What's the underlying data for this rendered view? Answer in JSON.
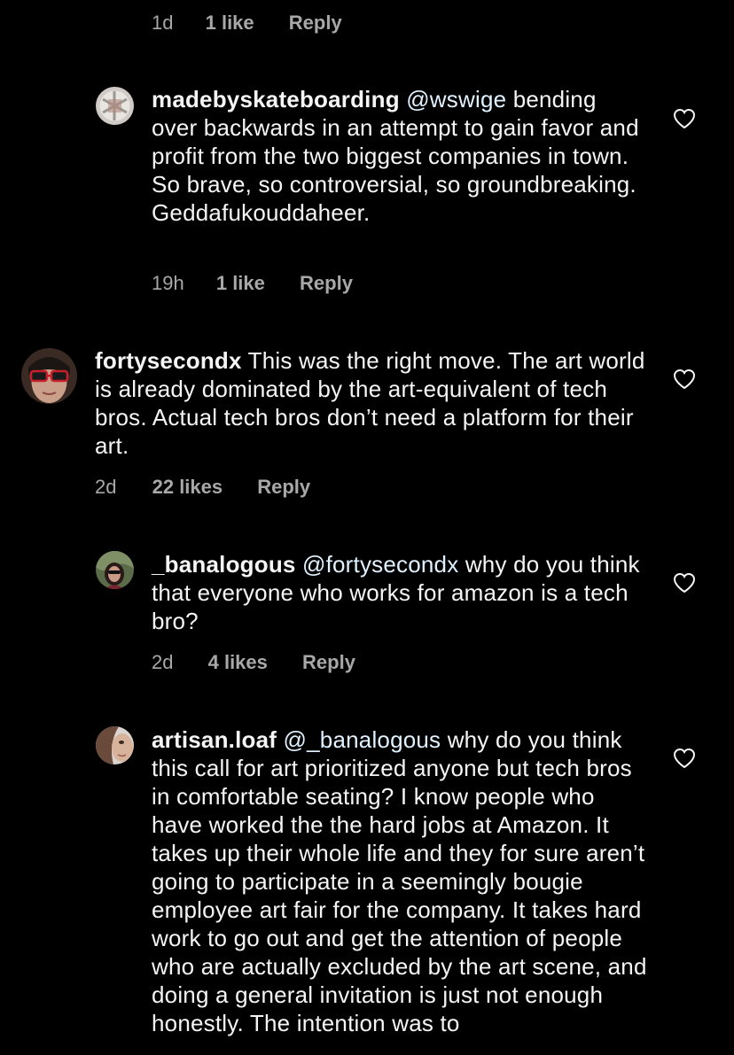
{
  "top_meta": {
    "time": "1d",
    "likes": "1 like",
    "reply": "Reply"
  },
  "comments": [
    {
      "username": "madebyskateboarding",
      "mention": "@wswige",
      "text": " bending over backwards in an attempt to gain favor and profit from the two biggest companies in town. So brave, so controversial, so groundbreaking. Geddafukouddaheer.",
      "time": "19h",
      "likes": "1 like",
      "reply": "Reply"
    },
    {
      "username": "fortysecondx",
      "mention": "",
      "text": " This was the right move. The art world is already dominated by the art-equivalent of tech bros. Actual tech bros don’t need a platform for their art.",
      "time": "2d",
      "likes": "22 likes",
      "reply": "Reply"
    },
    {
      "username": "_banalogous",
      "mention": "@fortysecondx",
      "text": " why do you think that everyone who works for amazon is a tech bro?",
      "time": "2d",
      "likes": "4 likes",
      "reply": "Reply"
    },
    {
      "username": "artisan.loaf",
      "mention": "@_banalogous",
      "text": " why do you think this call for art prioritized anyone but tech bros in comfortable seating? I know people who have worked the the hard jobs at Amazon. It takes up their whole life and they for sure aren’t going to participate in a seemingly bougie employee art fair for the company. It takes hard work to go out and get the attention of people who are actually excluded by the art scene, and doing a general invitation is just not enough honestly. The intention was to"
    }
  ],
  "colors": {
    "background": "#000000",
    "text": "#f5f5f5",
    "meta": "#a8a8a8",
    "mention": "#e0f1ff"
  },
  "icons": {
    "like": "heart-icon",
    "avatar": "avatar"
  }
}
